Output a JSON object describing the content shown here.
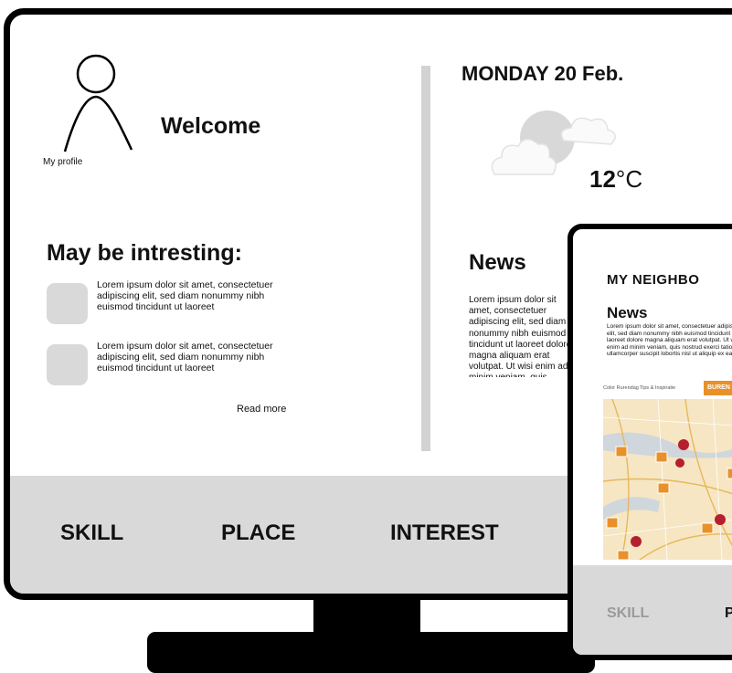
{
  "desktop": {
    "profile": {
      "label": "My profile"
    },
    "welcome": "Welcome",
    "date": "MONDAY 20 Feb.",
    "weather": {
      "temp_value": "12",
      "temp_unit": "°C",
      "icon": "cloud-moon-icon"
    },
    "interesting": {
      "title": "May be intresting:",
      "items": [
        {
          "text": "Lorem ipsum dolor sit amet, consectetuer adipiscing elit, sed diam nonummy nibh euismod tincidunt ut laoreet"
        },
        {
          "text": "Lorem ipsum dolor sit amet, consectetuer adipiscing elit, sed diam nonummy nibh euismod tincidunt ut laoreet"
        }
      ],
      "read_more": "Read more"
    },
    "news": {
      "title": "News",
      "text": "Lorem ipsum dolor sit amet, consectetuer adipiscing elit, sed diam nonummy nibh euismod tincidunt ut laoreet dolore magna aliquam erat volutpat. Ut wisi enim ad minim veniam, quis nostrud exerci tation ullamcorper suscipit lobortis nisl ut aliquip ex ea commodo"
    },
    "nav": [
      "SKILL",
      "PLACE",
      "INTEREST"
    ]
  },
  "tablet": {
    "title": "MY NEIGHBO",
    "news_title": "News",
    "news_text": "Lorem ipsum dolor sit amet, consectetuer adipiscing elit, sed diam nonummy nibh euismod tincidunt ut laoreet dolore magna aliquam erat volutpat. Ut wisi enim ad minim veniam, quis nostrud exerci tation ullamcorper suscipit lobortis nisl ut aliquip ex ea c",
    "map_tabs": [
      "Color Rurendag",
      "Tips & Inspiratie"
    ],
    "map_badge": "BUREN",
    "nav": [
      "SKILL",
      "P"
    ]
  },
  "colors": {
    "bar_gray": "#d9d9d9",
    "divider_gray": "#d2d2d2",
    "map_pin_red": "#b5202e",
    "map_pin_orange": "#e8912a"
  }
}
